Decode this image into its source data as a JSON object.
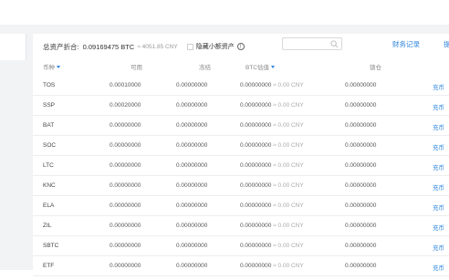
{
  "summary": {
    "label": "总资产折合:",
    "btc": "0.09169475 BTC",
    "approx": "≈ 4051.85 CNY",
    "hide_small_label": "隐藏小额资产",
    "records_link": "财务记录",
    "records_link2": "提币"
  },
  "table": {
    "headers": {
      "symbol": "币种",
      "available": "可用",
      "frozen": "冻结",
      "btc_value": "BTC估值",
      "locked": "锁仓"
    },
    "rows": [
      {
        "symbol": "TOS",
        "available": "0.00010000",
        "frozen": "0.00000000",
        "btc": "0.00000000",
        "cny": "≈ 0.00 CNY",
        "locked": "0.00000000",
        "action": "充币"
      },
      {
        "symbol": "SSP",
        "available": "0.00020000",
        "frozen": "0.00000000",
        "btc": "0.00000000",
        "cny": "≈ 0.00 CNY",
        "locked": "0.00000000",
        "action": "充币"
      },
      {
        "symbol": "BAT",
        "available": "0.00000000",
        "frozen": "0.00000000",
        "btc": "0.00000000",
        "cny": "≈ 0.00 CNY",
        "locked": "0.00000000",
        "action": "充币"
      },
      {
        "symbol": "SOC",
        "available": "0.00000000",
        "frozen": "0.00000000",
        "btc": "0.00000000",
        "cny": "≈ 0.00 CNY",
        "locked": "0.00000000",
        "action": "充币"
      },
      {
        "symbol": "LTC",
        "available": "0.00000000",
        "frozen": "0.00000000",
        "btc": "0.00000000",
        "cny": "≈ 0.00 CNY",
        "locked": "0.00000000",
        "action": "充币"
      },
      {
        "symbol": "KNC",
        "available": "0.00000000",
        "frozen": "0.00000000",
        "btc": "0.00000000",
        "cny": "≈ 0.00 CNY",
        "locked": "0.00000000",
        "action": "充币"
      },
      {
        "symbol": "ELA",
        "available": "0.00000000",
        "frozen": "0.00000000",
        "btc": "0.00000000",
        "cny": "≈ 0.00 CNY",
        "locked": "0.00000000",
        "action": "充币"
      },
      {
        "symbol": "ZIL",
        "available": "0.00000000",
        "frozen": "0.00000000",
        "btc": "0.00000000",
        "cny": "≈ 0.00 CNY",
        "locked": "0.00000000",
        "action": "充币"
      },
      {
        "symbol": "SBTC",
        "available": "0.00000000",
        "frozen": "0.00000000",
        "btc": "0.00000000",
        "cny": "≈ 0.00 CNY",
        "locked": "0.00000000",
        "action": "充币"
      },
      {
        "symbol": "ETF",
        "available": "0.00000000",
        "frozen": "0.00000000",
        "btc": "0.00000000",
        "cny": "≈ 0.00 CNY",
        "locked": "0.00000000",
        "action": "充币"
      }
    ]
  },
  "colors": {
    "accent": "#2e86de",
    "background": "#f2f3f5"
  },
  "icons": {
    "search": "search-icon",
    "info": "info-icon",
    "sort": "sort-icon"
  }
}
